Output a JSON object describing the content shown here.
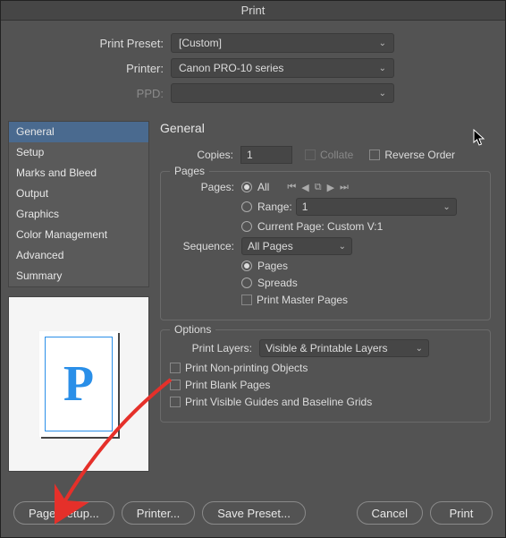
{
  "title": "Print",
  "top": {
    "preset_label": "Print Preset:",
    "preset_value": "[Custom]",
    "printer_label": "Printer:",
    "printer_value": "Canon PRO-10 series",
    "ppd_label": "PPD:",
    "ppd_value": ""
  },
  "sidebar": {
    "items": [
      {
        "label": "General",
        "selected": true
      },
      {
        "label": "Setup"
      },
      {
        "label": "Marks and Bleed"
      },
      {
        "label": "Output"
      },
      {
        "label": "Graphics"
      },
      {
        "label": "Color Management"
      },
      {
        "label": "Advanced"
      },
      {
        "label": "Summary"
      }
    ]
  },
  "preview": {
    "glyph": "P"
  },
  "content": {
    "panel_title": "General",
    "copies_label": "Copies:",
    "copies_value": "1",
    "collate": "Collate",
    "reverse": "Reverse Order",
    "pages_group": "Pages",
    "pages_label": "Pages:",
    "pages_all": "All",
    "range_label": "Range:",
    "range_value": "1",
    "current_page": "Current Page: Custom V:1",
    "sequence_label": "Sequence:",
    "sequence_value": "All Pages",
    "pages_radio": "Pages",
    "spreads_radio": "Spreads",
    "print_master": "Print Master Pages",
    "options_group": "Options",
    "layers_label": "Print Layers:",
    "layers_value": "Visible & Printable Layers",
    "nonprinting": "Print Non-printing Objects",
    "blank": "Print Blank Pages",
    "guides": "Print Visible Guides and Baseline Grids"
  },
  "buttons": {
    "page_setup": "Page Setup...",
    "printer": "Printer...",
    "save_preset": "Save Preset...",
    "cancel": "Cancel",
    "print": "Print"
  }
}
